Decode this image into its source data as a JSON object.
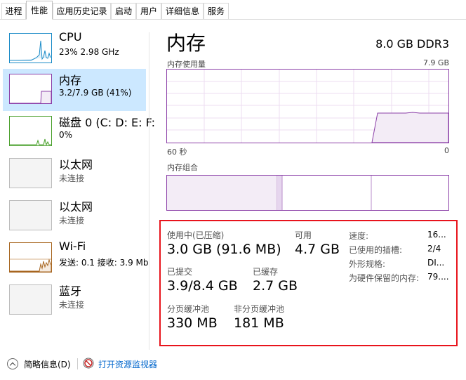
{
  "tabs": [
    {
      "label": "进程"
    },
    {
      "label": "性能"
    },
    {
      "label": "应用历史记录"
    },
    {
      "label": "启动"
    },
    {
      "label": "用户"
    },
    {
      "label": "详细信息"
    },
    {
      "label": "服务"
    }
  ],
  "sidebar": {
    "items": [
      {
        "name": "CPU",
        "sub": "23%  2.98 GHz",
        "color": "#1a8bc7"
      },
      {
        "name": "内存",
        "sub": "3.2/7.9 GB (41%)",
        "color": "#8b3fa8"
      },
      {
        "name": "磁盘 0 (C: D: E: F:",
        "sub": "0%",
        "color": "#4aa02c"
      },
      {
        "name": "以太网",
        "sub": "未连接",
        "color": "#bcbcbc"
      },
      {
        "name": "以太网",
        "sub": "未连接",
        "color": "#bcbcbc"
      },
      {
        "name": "Wi-Fi",
        "sub": "发送: 0.1  接收: 3.9 Mb",
        "color": "#a7651f"
      },
      {
        "name": "蓝牙",
        "sub": "未连接",
        "color": "#bcbcbc"
      }
    ]
  },
  "main": {
    "title": "内存",
    "spec": "8.0 GB DDR3",
    "usage_chart": {
      "label": "内存使用量",
      "max": "7.9 GB",
      "left_axis": "60 秒",
      "right_axis": "0"
    },
    "composition_label": "内存组合",
    "stats": {
      "in_use_label": "使用中(已压缩)",
      "in_use_value": "3.0 GB (91.6 MB)",
      "available_label": "可用",
      "available_value": "4.7 GB",
      "committed_label": "已提交",
      "committed_value": "3.9/8.4 GB",
      "cached_label": "已缓存",
      "cached_value": "2.7 GB",
      "paged_label": "分页缓冲池",
      "paged_value": "330 MB",
      "nonpaged_label": "非分页缓冲池",
      "nonpaged_value": "181 MB"
    },
    "details": [
      {
        "label": "速度:",
        "value": "16..."
      },
      {
        "label": "已使用的插槽:",
        "value": "2/4"
      },
      {
        "label": "外形规格:",
        "value": "DI..."
      },
      {
        "label": "为硬件保留的内存:",
        "value": "79...."
      }
    ],
    "accent_color": "#8b3fa8",
    "highlight_color": "#e8141c"
  },
  "footer": {
    "summary_label": "简略信息(D)",
    "monitor_label": "打开资源监视器"
  }
}
